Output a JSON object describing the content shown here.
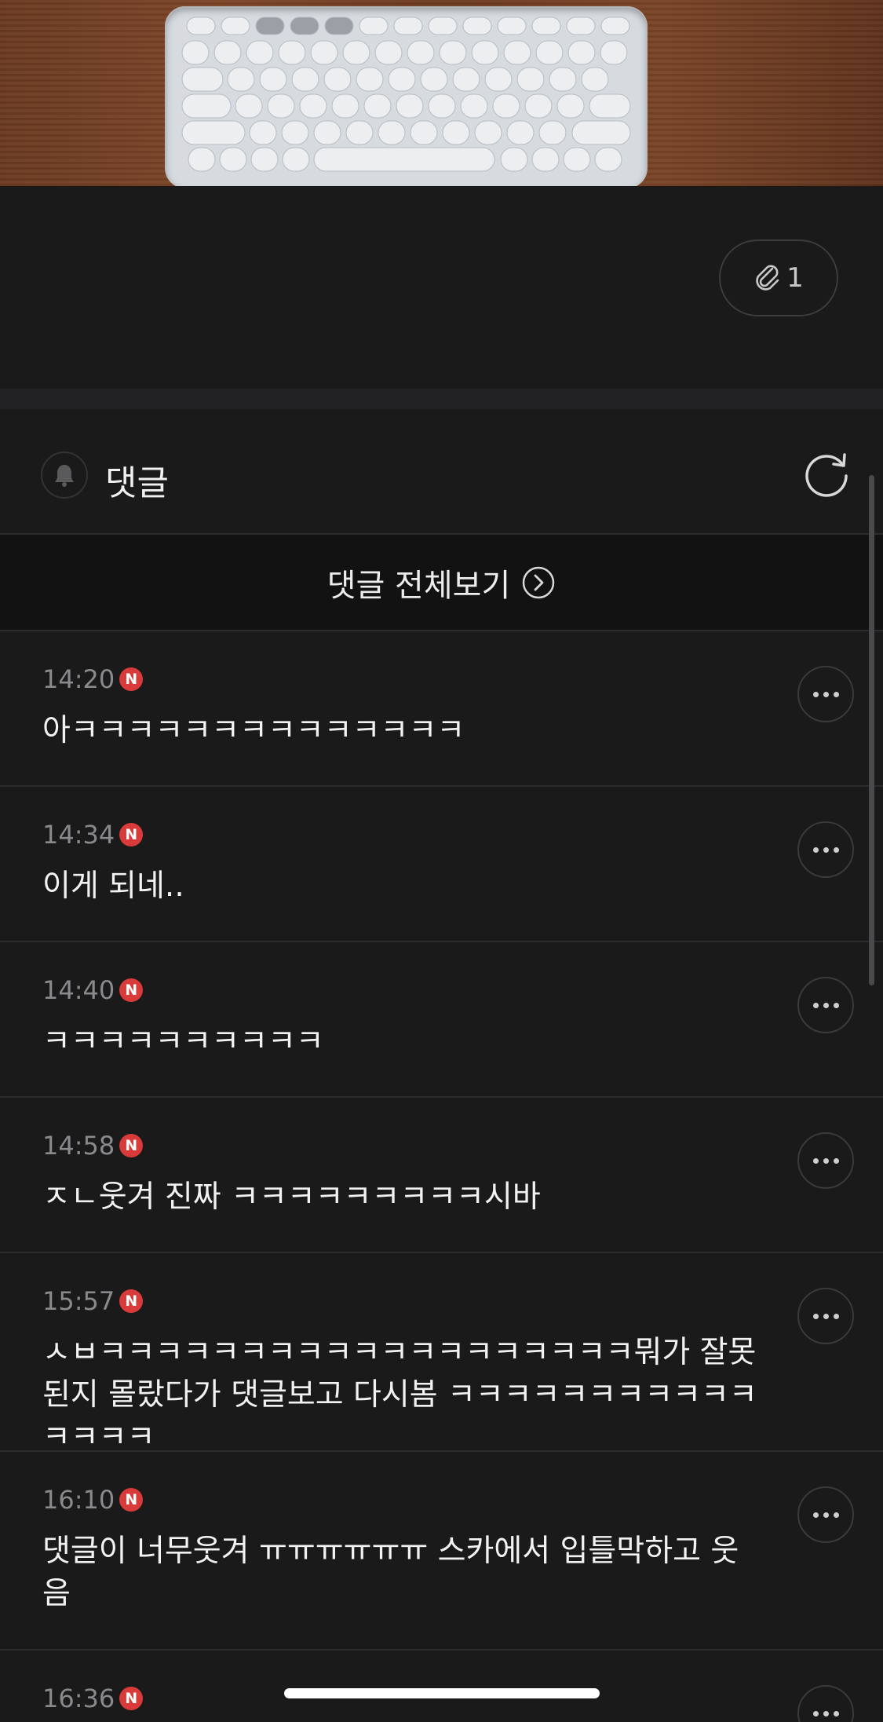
{
  "attachment": {
    "count": "1",
    "icon": "paperclip-icon"
  },
  "comments_section": {
    "title": "댓글",
    "view_all_label": "댓글 전체보기",
    "new_badge": "N",
    "items": [
      {
        "time": "14:20",
        "text": "아ㅋㅋㅋㅋㅋㅋㅋㅋㅋㅋㅋㅋㅋㅋ"
      },
      {
        "time": "14:34",
        "text": "이게 되네.."
      },
      {
        "time": "14:40",
        "text": "ㅋㅋㅋㅋㅋㅋㅋㅋㅋㅋ"
      },
      {
        "time": "14:58",
        "text": "ㅈㄴ웃겨 진짜 ㅋㅋㅋㅋㅋㅋㅋㅋㅋ시바"
      },
      {
        "time": "15:57",
        "text": "ㅅㅂㅋㅋㅋㅋㅋㅋㅋㅋㅋㅋㅋㅋㅋㅋㅋㅋㅋㅋㅋ뭐가 잘못된지 몰랐다가 댓글보고 다시봄 ㅋㅋㅋㅋㅋㅋㅋㅋㅋㅋㅋㅋㅋㅋㅋ"
      },
      {
        "time": "16:10",
        "text": "댓글이 너무웃겨 ㅠㅠㅠㅠㅠㅠ 스카에서 입틀막하고 웃음"
      },
      {
        "time": "16:36",
        "text": ""
      }
    ]
  },
  "colors": {
    "background": "#1a1a1b",
    "badge": "#d93a3a",
    "divider": "#2c2c2e"
  }
}
